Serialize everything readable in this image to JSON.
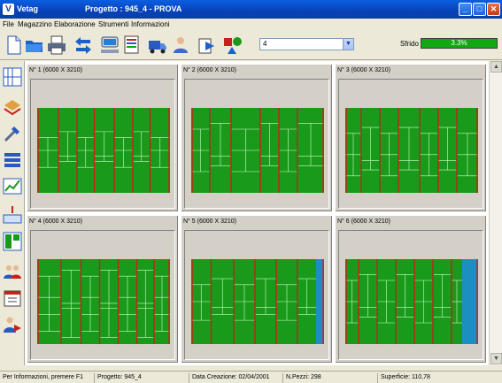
{
  "window": {
    "app_name": "Vetag",
    "doc_title": "Progetto : 945_4 - PROVA",
    "app_icon_glyph": "V",
    "minimize_glyph": "_",
    "maximize_glyph": "□",
    "close_glyph": "✕"
  },
  "menu": {
    "items": [
      "File",
      "Magazzino",
      "Elaborazione",
      "Strumenti",
      "Informazioni"
    ]
  },
  "toolbar": {
    "icons": [
      "new-document-icon",
      "open-folder-icon",
      "print-icon",
      "swap-arrows-icon",
      "network-icon",
      "report-icon",
      "truck-icon",
      "user-icon",
      "export-icon",
      "shapes-icon"
    ],
    "sheet_select_value": "4",
    "sheet_select_arrow": "▼",
    "sfrido_label": "Sfrido",
    "sfrido_value": "3.3%",
    "sfrido_fraction": 0.033,
    "sfrido_color": "#11a812"
  },
  "sidebar": {
    "icons": [
      "grid-layout-icon",
      "materials-icon",
      "tools-icon",
      "stack-icon",
      "graph-icon",
      "cut-icon",
      "arrange-icon",
      "people-icon",
      "calendar-icon",
      "person-export-icon"
    ]
  },
  "panels": [
    {
      "label": "N° 1 (6000 X 3210)"
    },
    {
      "label": "N° 2 (6000 X 3210)"
    },
    {
      "label": "N° 3 (6000 X 3210)"
    },
    {
      "label": "N° 4 (6000 X 3210)"
    },
    {
      "label": "N° 5 (6000 X 3210)"
    },
    {
      "label": "N° 6 (6000 X 3210)"
    }
  ],
  "colors": {
    "piece_fill": "#1a9a1a",
    "piece_line": "#c8ffc8",
    "cut_line": "#c8201a",
    "waste": "#1b8fc2"
  },
  "scrollbar": {
    "up_glyph": "▲",
    "down_glyph": "▼"
  },
  "status": {
    "hint": "Per Informazioni, premere F1",
    "project": "Progetto: 945_4",
    "created": "Data Creazione: 02/04/2001",
    "pieces": "N.Pezzi: 298",
    "surface": "Superficie: 110,78"
  }
}
